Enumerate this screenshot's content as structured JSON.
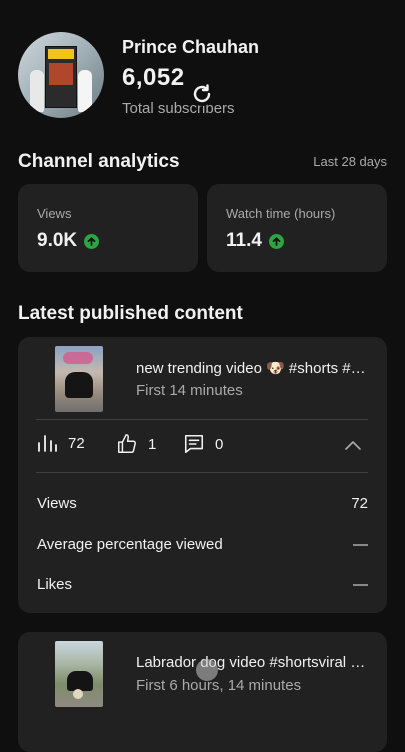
{
  "channel": {
    "name": "Prince Chauhan",
    "subscriber_count": "6,052",
    "subscriber_label": "Total subscribers"
  },
  "analytics": {
    "title": "Channel analytics",
    "period": "Last 28 days",
    "stats": [
      {
        "label": "Views",
        "value": "9.0K",
        "trend": "up"
      },
      {
        "label": "Watch time (hours)",
        "value": "11.4",
        "trend": "up"
      }
    ]
  },
  "latest": {
    "title": "Latest published content",
    "items": [
      {
        "title": "new trending video 🐶 #shorts #shortsviral",
        "age": "First 14 minutes",
        "views": "72",
        "likes": "1",
        "comments": "0",
        "details": [
          {
            "label": "Views",
            "value": "72"
          },
          {
            "label": "Average percentage viewed",
            "value": "—"
          },
          {
            "label": "Likes",
            "value": "—"
          }
        ]
      },
      {
        "title": "Labrador dog video #shortsviral #shorts",
        "age": "First 6 hours, 14 minutes"
      }
    ]
  },
  "colors": {
    "background": "#0f0f0f",
    "card": "#212121",
    "trend_up": "#2ba640",
    "secondary_text": "#aaaaaa"
  },
  "icons": {
    "refresh": "refresh-icon",
    "trend": "arrow-up-circle-icon",
    "views": "bar-chart-icon",
    "likes": "thumbs-up-icon",
    "comments": "comment-icon",
    "collapse": "chevron-up-icon"
  }
}
